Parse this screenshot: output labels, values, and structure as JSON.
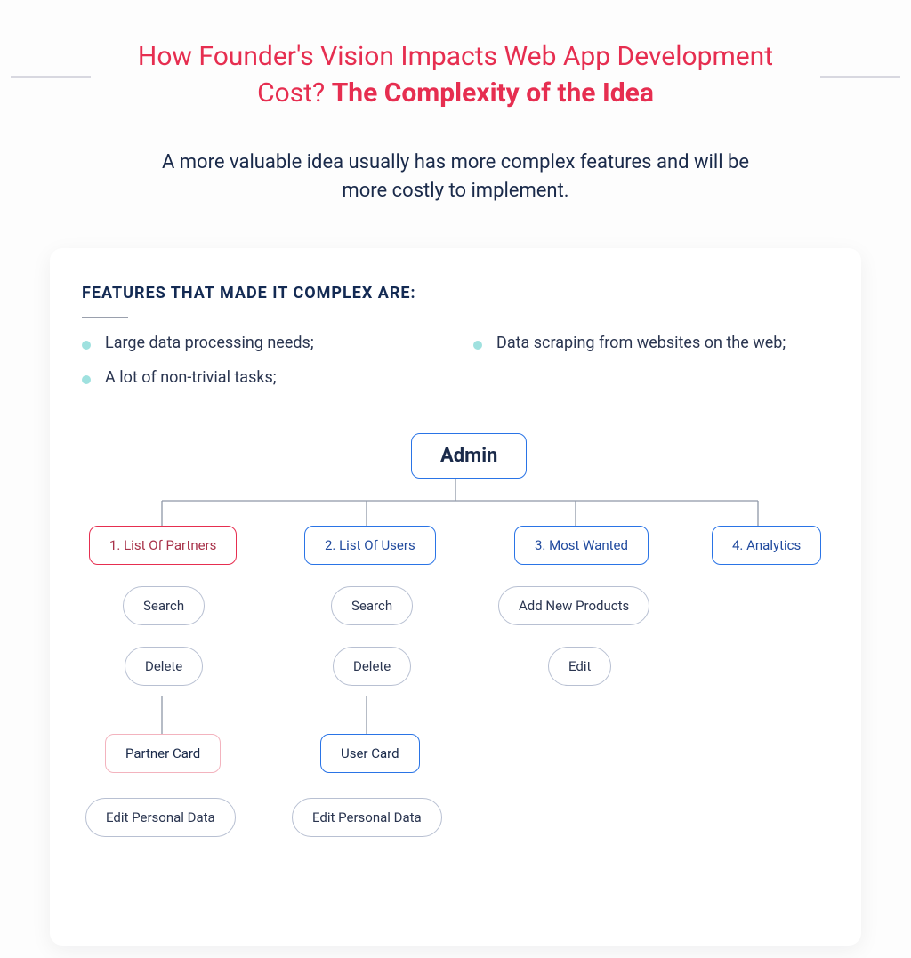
{
  "colors": {
    "accent_red": "#e62e50",
    "accent_blue": "#2a74e6",
    "bullet_teal": "#9fe1df",
    "text_navy": "#132a53",
    "border_gray": "#b8c0d2"
  },
  "title_light": "How Founder's Vision Impacts Web App Development Cost? ",
  "title_bold": "The Complexity of the Idea",
  "subtitle": "A more valuable idea usually has more complex features and will be more costly to implement.",
  "card": {
    "heading": "FEATURES THAT MADE IT COMPLEX ARE:",
    "features_left": [
      "Large data processing needs;",
      "A lot of non-trivial tasks;"
    ],
    "features_right": [
      "Data scraping from websites on the web;"
    ]
  },
  "diagram": {
    "root": "Admin",
    "branches": [
      {
        "label": "1. List Of Partners",
        "style": "red",
        "children": [
          "Search",
          "Delete"
        ],
        "subcard": "Partner Card",
        "leaf": "Edit Personal Data"
      },
      {
        "label": "2. List Of Users",
        "style": "blue",
        "children": [
          "Search",
          "Delete"
        ],
        "subcard": "User Card",
        "leaf": "Edit Personal Data"
      },
      {
        "label": "3. Most Wanted",
        "style": "blue",
        "children": [
          "Add New Products",
          "Edit"
        ]
      },
      {
        "label": "4. Analytics",
        "style": "blue",
        "children": []
      }
    ]
  }
}
